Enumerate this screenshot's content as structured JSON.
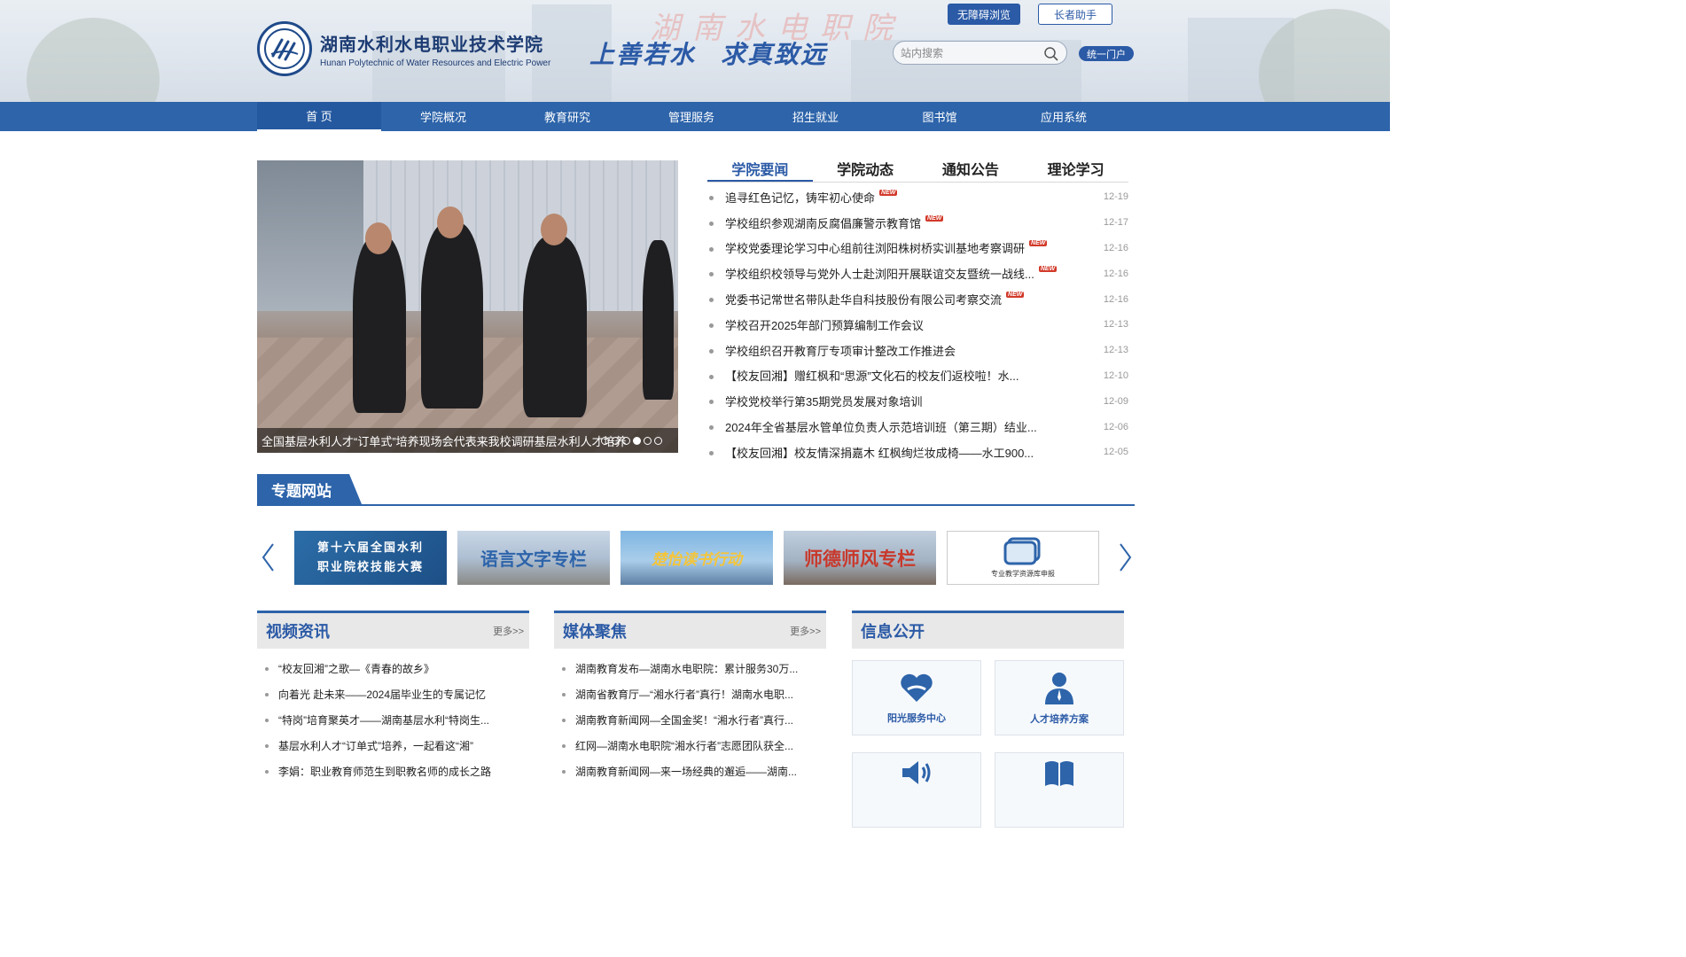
{
  "header": {
    "college_name_cn": "湖南水利水电职业技术学院",
    "college_name_en": "Hunan Polytechnic of Water Resources and Electric Power",
    "watermark": "湖南水电职院",
    "motto": [
      "上善若水",
      "求真致远"
    ],
    "accessibility_button": "无障碍浏览",
    "elder_button": "长者助手",
    "search_placeholder": "站内搜索",
    "portal_button": "统一门户"
  },
  "nav": [
    "首 页",
    "学院概况",
    "教育研究",
    "管理服务",
    "招生就业",
    "图书馆",
    "应用系统"
  ],
  "slider": {
    "caption": "全国基层水利人才“订单式”培养现场会代表来我校调研基层水利人才培养",
    "dots": 6,
    "active_dot": 4
  },
  "news_tabs": [
    "学院要闻",
    "学院动态",
    "通知公告",
    "理论学习"
  ],
  "news": [
    {
      "title": "追寻红色记忆，铸牢初心使命",
      "date": "12-19",
      "new": true
    },
    {
      "title": "学校组织参观湖南反腐倡廉警示教育馆",
      "date": "12-17",
      "new": true
    },
    {
      "title": "学校党委理论学习中心组前往浏阳株树桥实训基地考察调研",
      "date": "12-16",
      "new": true
    },
    {
      "title": "学校组织校领导与党外人士赴浏阳开展联谊交友暨统一战线...",
      "date": "12-16",
      "new": true
    },
    {
      "title": "党委书记常世名带队赴华自科技股份有限公司考察交流",
      "date": "12-16",
      "new": true
    },
    {
      "title": "学校召开2025年部门预算编制工作会议",
      "date": "12-13",
      "new": false
    },
    {
      "title": "学校组织召开教育厅专项审计整改工作推进会",
      "date": "12-13",
      "new": false
    },
    {
      "title": "【校友回湘】赠红枫和“思源”文化石的校友们返校啦！水...",
      "date": "12-10",
      "new": false
    },
    {
      "title": "学校党校举行第35期党员发展对象培训",
      "date": "12-09",
      "new": false
    },
    {
      "title": "2024年全省基层水管单位负责人示范培训班（第三期）结业...",
      "date": "12-06",
      "new": false
    },
    {
      "title": "【校友回湘】校友情深捐嘉木 红枫绚烂妆成椅——水工900...",
      "date": "12-05",
      "new": false
    }
  ],
  "new_badge": "NEW",
  "special_sites": {
    "title": "专题网站",
    "items": [
      "第十六届全国水利职业院校技能大赛",
      "语言文字专栏",
      "楚怡读书行动",
      "师德师风专栏",
      "专业教学资源库申报"
    ]
  },
  "video": {
    "title": "视频资讯",
    "more": "更多>>",
    "items": [
      "“校友回湘”之歌—《青春的故乡》",
      "向着光 赴未来——2024届毕业生的专属记忆",
      "“特岗”培育聚英才——湖南基层水利“特岗生...",
      "基层水利人才“订单式”培养，一起看这“湘”",
      "李娟：职业教育师范生到职教名师的成长之路"
    ]
  },
  "media": {
    "title": "媒体聚焦",
    "more": "更多>>",
    "items": [
      "湖南教育发布—湖南水电职院：累计服务30万...",
      "湖南省教育厅—“湘水行者”真行！湖南水电职...",
      "湖南教育新闻网—全国金奖！“湘水行者”真行...",
      "红网—湖南水电职院“湘水行者”志愿团队获全...",
      "湖南教育新闻网—来一场经典的邂逅——湖南..."
    ]
  },
  "info": {
    "title": "信息公开",
    "items": [
      "阳光服务中心",
      "人才培养方案"
    ]
  },
  "colors": {
    "primary": "#2d64aa",
    "accent_red": "#d23a2a"
  }
}
